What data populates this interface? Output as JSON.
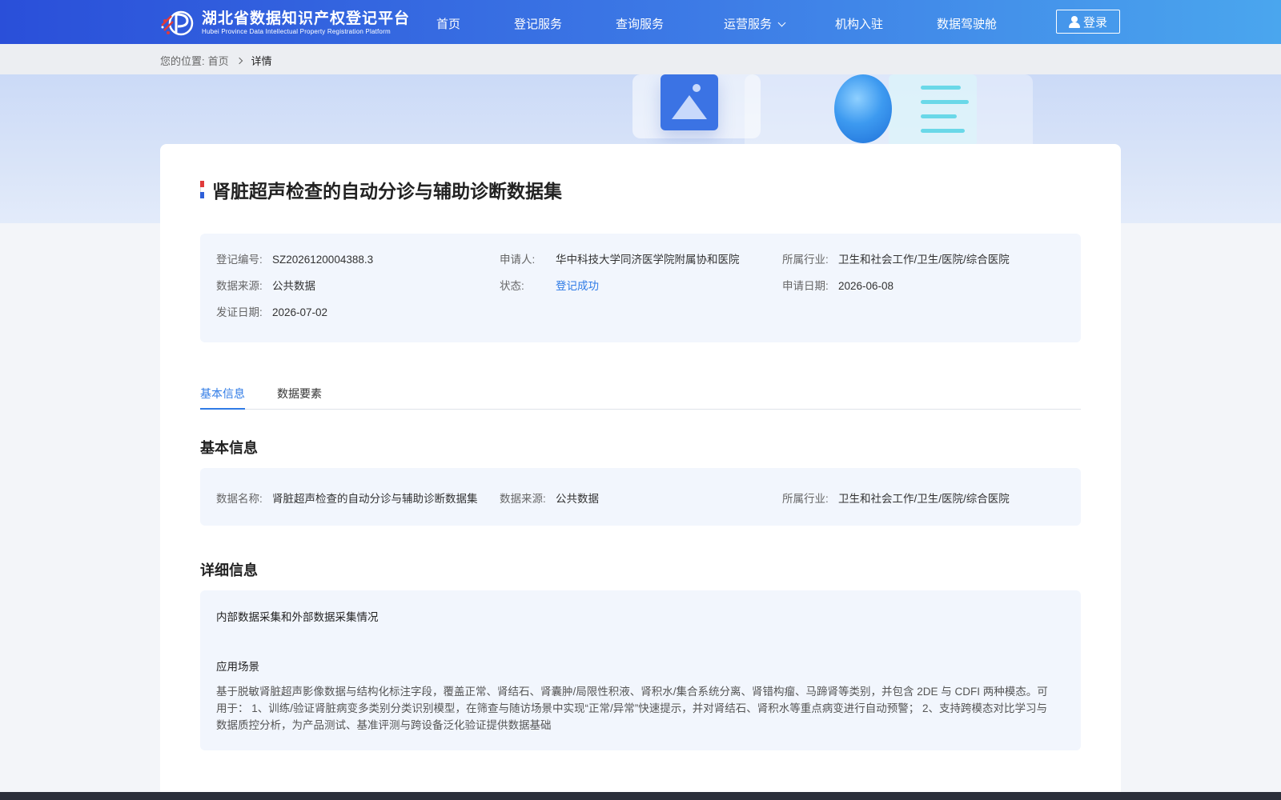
{
  "header": {
    "logo_cn": "湖北省数据知识产权登记平台",
    "logo_en": "Hubei Province Data Intellectual Property Registration Platform",
    "nav": [
      {
        "label": "首页"
      },
      {
        "label": "登记服务"
      },
      {
        "label": "查询服务"
      },
      {
        "label": "运营服务"
      },
      {
        "label": "机构入驻"
      },
      {
        "label": "数据驾驶舱"
      }
    ],
    "login_label": "登录"
  },
  "breadcrumb": {
    "prefix": "您的位置:",
    "home": "首页",
    "current": "详情"
  },
  "detail": {
    "title": "肾脏超声检查的自动分诊与辅助诊断数据集",
    "meta": {
      "reg_no": {
        "label": "登记编号:",
        "value": "SZ2026120004388.3"
      },
      "applicant": {
        "label": "申请人:",
        "value": "华中科技大学同济医学院附属协和医院"
      },
      "industry": {
        "label": "所属行业:",
        "value": "卫生和社会工作/卫生/医院/综合医院"
      },
      "source": {
        "label": "数据来源:",
        "value": "公共数据"
      },
      "status": {
        "label": "状态:",
        "value": "登记成功"
      },
      "apply_date": {
        "label": "申请日期:",
        "value": "2026-06-08"
      },
      "issue_date": {
        "label": "发证日期:",
        "value": "2026-07-02"
      }
    },
    "tabs": [
      {
        "label": "基本信息"
      },
      {
        "label": "数据要素"
      }
    ],
    "basic": {
      "heading": "基本信息",
      "name": {
        "label": "数据名称:",
        "value": "肾脏超声检查的自动分诊与辅助诊断数据集"
      },
      "source": {
        "label": "数据来源:",
        "value": "公共数据"
      },
      "industry": {
        "label": "所属行业:",
        "value": "卫生和社会工作/卫生/医院/综合医院"
      }
    },
    "more": {
      "heading": "详细信息",
      "collection_title": "内部数据采集和外部数据采集情况",
      "scenario_title": "应用场景",
      "scenario_text": "基于脱敏肾脏超声影像数据与结构化标注字段，覆盖正常、肾结石、肾囊肿/局限性积液、肾积水/集合系统分离、肾错构瘤、马蹄肾等类别，并包含 2DE 与 CDFI 两种模态。可用于： 1、训练/验证肾脏病变多类别分类识别模型，在筛查与随访场景中实现“正常/异常”快速提示，并对肾结石、肾积水等重点病变进行自动预警； 2、支持跨模态对比学习与数据质控分析，为产品测试、基准评测与跨设备泛化验证提供数据基础"
    }
  },
  "colors": {
    "header_start": "#2a4fd9",
    "header_end": "#4aa6ee",
    "accent": "#2f7be6",
    "info_bg": "#f2f6fd"
  }
}
